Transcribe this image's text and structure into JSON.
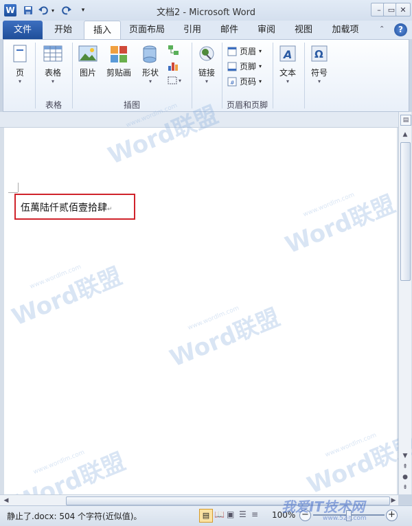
{
  "window": {
    "title": "文档2 - Microsoft Word",
    "app_icon": "W",
    "controls": {
      "minimize": "–",
      "restore": "▭",
      "close": "✕"
    }
  },
  "quick_access": {
    "save_icon": "floppy-icon",
    "undo_icon": "undo-icon",
    "redo_icon": "redo-icon",
    "customize": "▾"
  },
  "tabs": [
    {
      "label": "文件"
    },
    {
      "label": "开始"
    },
    {
      "label": "插入"
    },
    {
      "label": "页面布局"
    },
    {
      "label": "引用"
    },
    {
      "label": "邮件"
    },
    {
      "label": "审阅"
    },
    {
      "label": "视图"
    },
    {
      "label": "加载项"
    }
  ],
  "tab_right": {
    "help": "?"
  },
  "ribbon": {
    "groups": {
      "pages": {
        "label": "",
        "button": "页"
      },
      "tables": {
        "label": "表格",
        "button": "表格"
      },
      "illustrations": {
        "label": "插图",
        "picture": "图片",
        "clipart": "剪贴画",
        "shapes": "形状"
      },
      "links": {
        "label": "",
        "button": "链接"
      },
      "header_footer": {
        "label": "页眉和页脚",
        "header": "页眉",
        "footer": "页脚",
        "page_number": "页码"
      },
      "text": {
        "label": "",
        "button": "文本"
      },
      "symbols": {
        "label": "",
        "button": "符号"
      }
    }
  },
  "document": {
    "text": "伍萬陆仟贰佰壹拾肆",
    "pilcrow": "↵"
  },
  "watermarks": [
    {
      "text": "Word联盟",
      "url": "www.wordlm.com"
    },
    {
      "text": "Word联盟",
      "url": "www.wordlm.com"
    },
    {
      "text": "Word联盟",
      "url": "www.wordlm.com"
    },
    {
      "text": "Word联盟",
      "url": "www.wordlm.com"
    },
    {
      "text": "Word联盟",
      "url": "www.wordlm.com"
    },
    {
      "text": "Word联盟",
      "url": "www.wordlm.com"
    },
    {
      "text": "Word联盟",
      "url": "www.wordlm.com"
    }
  ],
  "status": {
    "left": "静止了.docx: 504 个字符(近似值)。",
    "zoom": "100%"
  },
  "site_watermark": {
    "text": "我爱IT技术网",
    "url": "www.52it.com"
  },
  "colors": {
    "accent": "#2b579a",
    "highlight_box": "#d0222a"
  }
}
